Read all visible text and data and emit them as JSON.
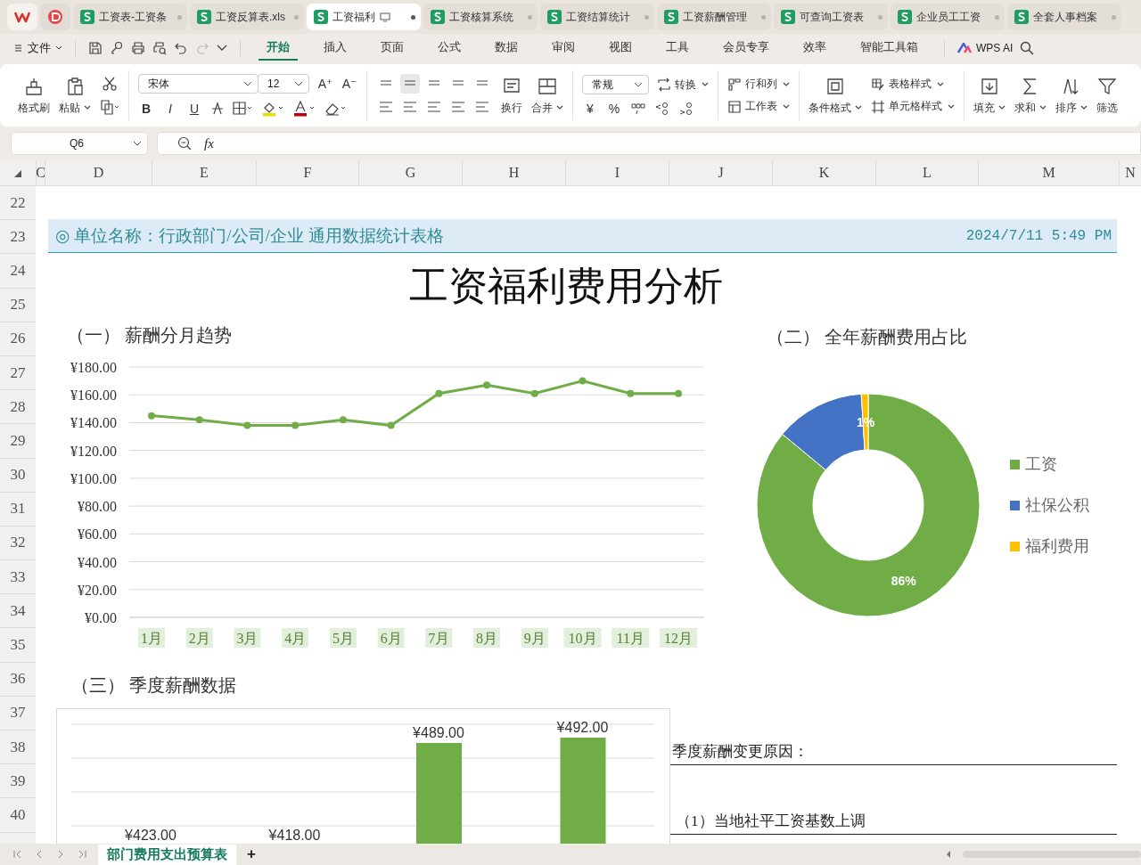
{
  "doc_tabs": [
    {
      "label": "工资表-工资条",
      "selected": false
    },
    {
      "label": "工资反算表.xls",
      "selected": false
    },
    {
      "label": "工资福利",
      "selected": true
    },
    {
      "label": "工资核算系统",
      "selected": false
    },
    {
      "label": "工资结算统计",
      "selected": false
    },
    {
      "label": "工资薪酬管理",
      "selected": false
    },
    {
      "label": "可查询工资表",
      "selected": false
    },
    {
      "label": "企业员工工资",
      "selected": false
    },
    {
      "label": "全套人事档案",
      "selected": false
    }
  ],
  "menu": {
    "file": "文件",
    "tabs": [
      {
        "label": "开始",
        "selected": true
      },
      {
        "label": "插入",
        "selected": false
      },
      {
        "label": "页面",
        "selected": false
      },
      {
        "label": "公式",
        "selected": false
      },
      {
        "label": "数据",
        "selected": false
      },
      {
        "label": "审阅",
        "selected": false
      },
      {
        "label": "视图",
        "selected": false
      },
      {
        "label": "工具",
        "selected": false
      },
      {
        "label": "会员专享",
        "selected": false
      },
      {
        "label": "效率",
        "selected": false
      },
      {
        "label": "智能工具箱",
        "selected": false
      }
    ],
    "ai": "WPS AI"
  },
  "ribbon": {
    "format_painter": "格式刷",
    "paste": "粘贴",
    "font": "宋体",
    "font_size": "12",
    "size_buttons": [
      "A⁺",
      "A⁻"
    ],
    "style_buttons": [
      "B",
      "I",
      "U"
    ],
    "wrap": "换行",
    "merge": "合并",
    "number_format": "常规",
    "convert": "转换",
    "number_buttons": [
      "¥",
      "%"
    ],
    "rows_cols": "行和列",
    "worksheet": "工作表",
    "cond_format": "条件格式",
    "table_style": "表格样式",
    "cell_style": "单元格样式",
    "fill": "填充",
    "sum": "求和",
    "sort": "排序",
    "filter": "筛选"
  },
  "formula_bar": {
    "cell": "Q6",
    "fx": "fx"
  },
  "columns": [
    "C",
    "D",
    "E",
    "F",
    "G",
    "H",
    "I",
    "J",
    "K",
    "L",
    "M",
    "N"
  ],
  "rows": [
    "22",
    "23",
    "24",
    "25",
    "26",
    "27",
    "28",
    "29",
    "30",
    "31",
    "32",
    "33",
    "34",
    "35",
    "36",
    "37",
    "38",
    "39",
    "40"
  ],
  "sheet": {
    "banner": {
      "text": "◎ 单位名称：行政部门/公司/企业 通用数据统计表格",
      "date": "2024/7/11 5:49 PM"
    },
    "title": "工资福利费用分析",
    "trend": {
      "title": "（一） 薪酬分月趋势",
      "chart_data": {
        "type": "line",
        "categories": [
          "1月",
          "2月",
          "3月",
          "4月",
          "5月",
          "6月",
          "7月",
          "8月",
          "9月",
          "10月",
          "11月",
          "12月"
        ],
        "series": [
          {
            "color": "#70ad47",
            "marker": "circle",
            "values": [
              145,
              142,
              138,
              138,
              142,
              138,
              161,
              167,
              161,
              170,
              161,
              161
            ]
          }
        ],
        "grid": true,
        "ylim": [
          0,
          180
        ],
        "yticks": [
          {
            "value": 0,
            "label": "¥0.00"
          },
          {
            "value": 20,
            "label": "¥20.00"
          },
          {
            "value": 40,
            "label": "¥40.00"
          },
          {
            "value": 60,
            "label": "¥60.00"
          },
          {
            "value": 80,
            "label": "¥80.00"
          },
          {
            "value": 100,
            "label": "¥100.00"
          },
          {
            "value": 120,
            "label": "¥120.00"
          },
          {
            "value": 140,
            "label": "¥140.00"
          },
          {
            "value": 160,
            "label": "¥160.00"
          },
          {
            "value": 180,
            "label": "¥180.00"
          }
        ]
      }
    },
    "share": {
      "title": "（二） 全年薪酬费用占比",
      "chart_data": {
        "type": "donut",
        "categories": [
          "工资",
          "社保公积",
          "福利费用"
        ],
        "values": [
          86,
          13,
          1
        ],
        "colors": [
          "#70ad47",
          "#4472c4",
          "#ffc000"
        ],
        "value_labels": [
          "86%",
          null,
          "1%"
        ],
        "legend": true
      }
    },
    "quarterly": {
      "title": "（三） 季度薪酬数据",
      "data_labels": [
        "¥423.00",
        "¥418.00",
        "¥489.00",
        "¥492.00"
      ]
    },
    "notes": [
      "季度薪酬变更原因：",
      "（1）当地社平工资基数上调"
    ]
  },
  "sheet_tabs": [
    {
      "label": "部门费用支出预算表",
      "selected": true
    }
  ],
  "add_sheet": "+"
}
